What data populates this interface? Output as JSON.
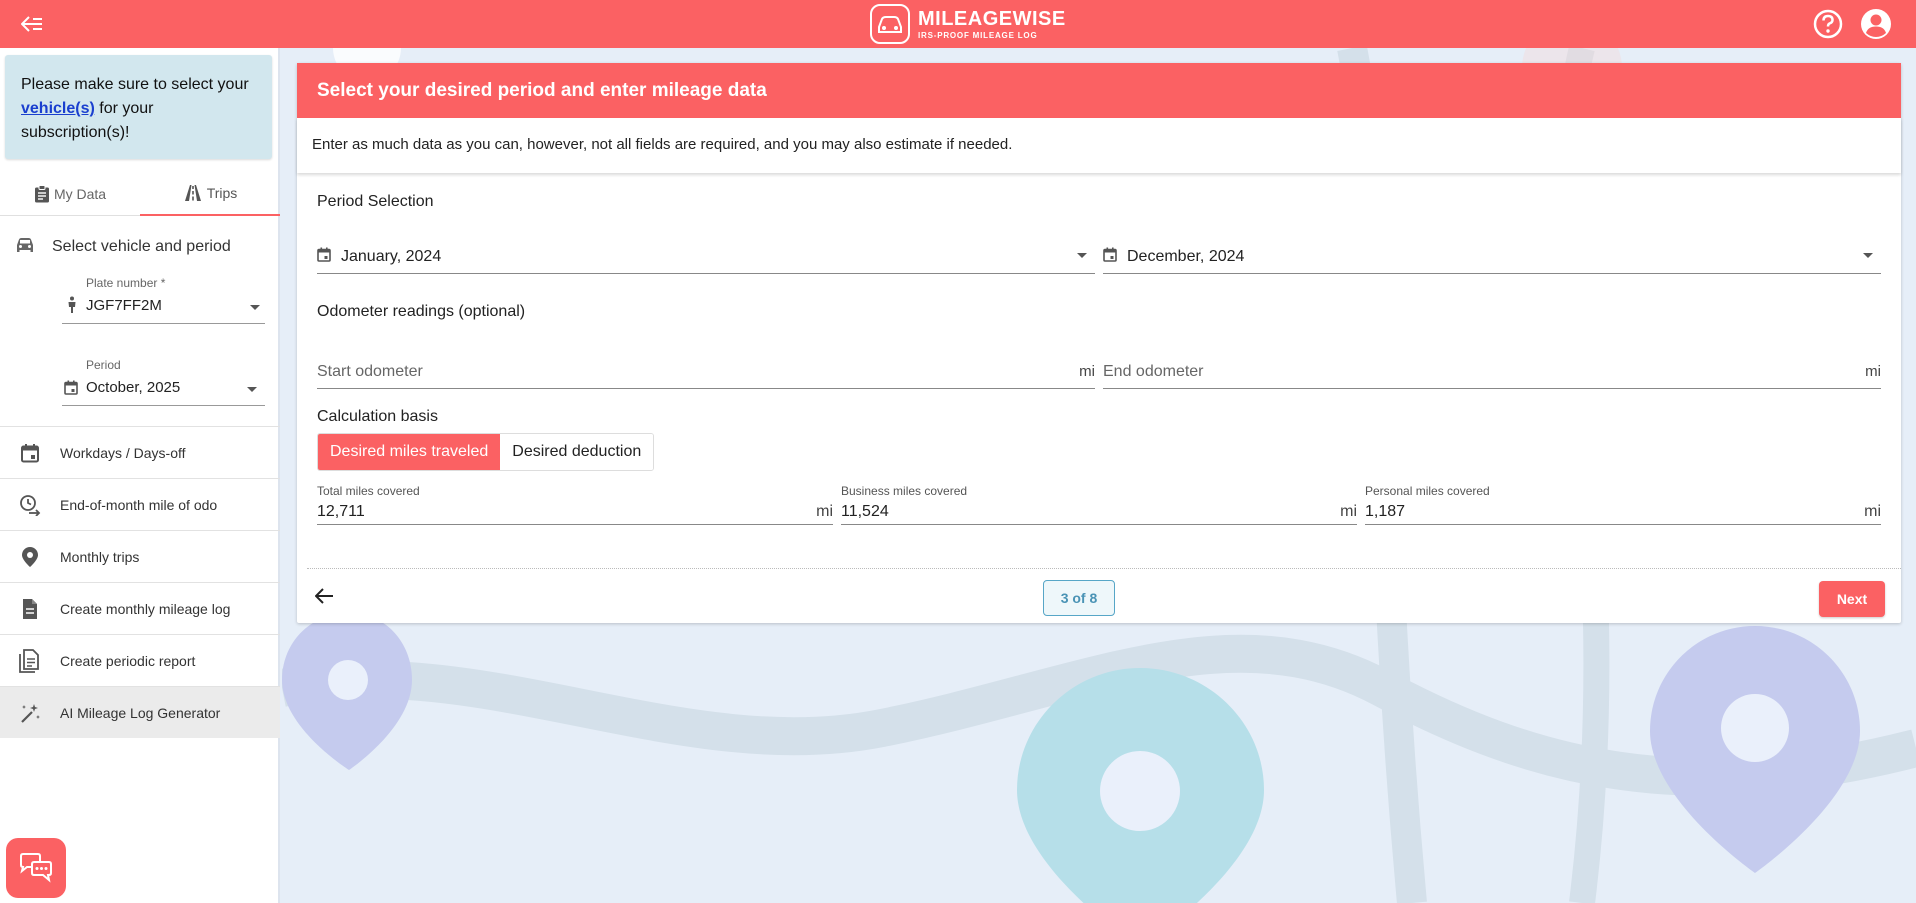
{
  "brand": {
    "title": "MILEAGEWISE",
    "subtitle": "IRS-PROOF MILEAGE LOG",
    "accent_color": "#fb6163"
  },
  "topbar": {
    "back_icon": "arrow-left-collapse-icon",
    "help_icon": "question-circle-icon",
    "account_icon": "account-circle-icon"
  },
  "sidebar": {
    "notice": {
      "before": "Please make sure to select your ",
      "link": "vehicle(s)",
      "after": " for your subscription(s)!"
    },
    "tabs": [
      {
        "label": "My Data",
        "icon": "clipboard-icon"
      },
      {
        "label": "Trips",
        "icon": "road-icon"
      }
    ],
    "section_title": "Select vehicle and period",
    "plate": {
      "label": "Plate number *",
      "value": "JGF7FF2M"
    },
    "period": {
      "label": "Period",
      "value": "October, 2025"
    },
    "menu": [
      {
        "label": "Workdays / Days-off",
        "icon": "calendar-icon"
      },
      {
        "label": "End-of-month mile of odo",
        "icon": "clock-arrow-icon"
      },
      {
        "label": "Monthly trips",
        "icon": "map-pin-icon"
      },
      {
        "label": "Create monthly mileage log",
        "icon": "document-icon"
      },
      {
        "label": "Create periodic report",
        "icon": "documents-icon"
      },
      {
        "label": "AI Mileage Log Generator",
        "icon": "magic-wand-icon"
      }
    ]
  },
  "card": {
    "header": "Select your desired period and enter mileage data",
    "subtitle": "Enter as much data as you can, however, not all fields are required, and you may also estimate if needed.",
    "period_section": "Period Selection",
    "period_start": "January, 2024",
    "period_end": "December, 2024",
    "odometer_section": "Odometer readings (optional)",
    "start_odometer": {
      "placeholder": "Start odometer",
      "unit": "mi"
    },
    "end_odometer": {
      "placeholder": "End odometer",
      "unit": "mi"
    },
    "calc_section": "Calculation basis",
    "calc_options": [
      "Desired miles traveled",
      "Desired deduction"
    ],
    "total": {
      "label": "Total miles covered",
      "value": "12,711",
      "unit": "mi"
    },
    "business": {
      "label": "Business miles covered",
      "value": "11,524",
      "unit": "mi"
    },
    "personal": {
      "label": "Personal miles covered",
      "value": "1,187",
      "unit": "mi"
    },
    "pager": "3 of 8",
    "next_label": "Next"
  }
}
